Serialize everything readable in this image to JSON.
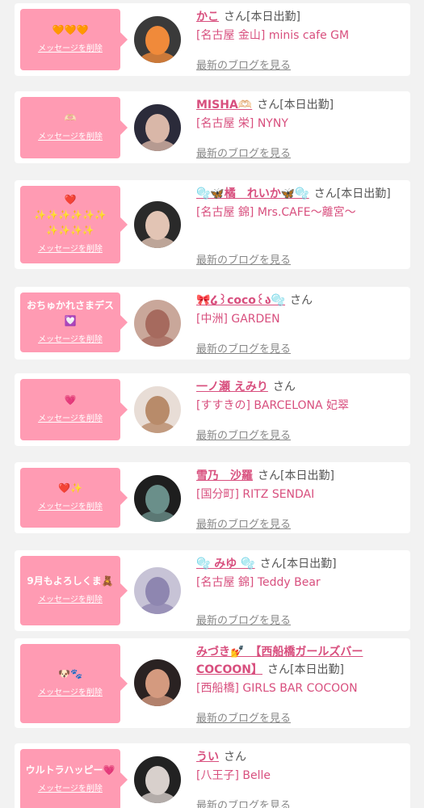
{
  "common": {
    "delete_label": "メッセージを削除",
    "blog_label": "最新のブログを見る",
    "san": "さん"
  },
  "cards": [
    {
      "message": "🧡🧡🧡",
      "name": "かこ",
      "status": "[本日出勤]",
      "shop": "[名古屋 金山] minis cafe GM",
      "avatar_colors": [
        "#3a3a3a",
        "#f08a3a"
      ]
    },
    {
      "message": "🫶🏻",
      "name": "MISHA🫶🏻",
      "status": "[本日出勤]",
      "shop": "[名古屋 栄] NYNY",
      "avatar_colors": [
        "#2b2b3a",
        "#d9b7a8"
      ]
    },
    {
      "message": "❤️\n✨✨✨✨✨✨\n✨✨✨✨",
      "name": "🫧🦋橘　れいか🦋🫧",
      "status": "[本日出勤]",
      "shop": "[名古屋 錦] Mrs.CAFE～離宮～",
      "avatar_colors": [
        "#2a2a2a",
        "#e2c4b4"
      ]
    },
    {
      "message": "おちゅかれさまデス💟",
      "name": "🎀໒꒱coco꒰ა🫧",
      "status": "",
      "shop": "[中洲] GARDEN",
      "avatar_colors": [
        "#c9a79a",
        "#a66a5e"
      ]
    },
    {
      "message": "💗",
      "name": "一ノ瀬 えみり",
      "status": "",
      "shop": "[すすきの] BARCELONA 妃翠",
      "avatar_colors": [
        "#e8ddd6",
        "#b88b6a"
      ]
    },
    {
      "message": "❤️✨",
      "name": "雪乃　沙羅",
      "status": "[本日出勤]",
      "shop": "[国分町] RITZ SENDAI",
      "avatar_colors": [
        "#1e1e1e",
        "#6a8f8a"
      ]
    },
    {
      "message": "9月もよろしくま🧸",
      "name": "🫧 みゆ 🫧",
      "status": "[本日出勤]",
      "shop": "[名古屋 錦] Teddy Bear",
      "avatar_colors": [
        "#c7c3d6",
        "#8e86b0"
      ]
    },
    {
      "message": "🐶🐾",
      "name": "みづき💅　【西船橋ガールズバーCOCOON】",
      "status": "[本日出勤]",
      "shop": "[西船橋] GIRLS BAR COCOON",
      "avatar_colors": [
        "#2a2222",
        "#d49a7f"
      ]
    },
    {
      "message": "ウルトラハッピー💗",
      "name": "うい",
      "status": "",
      "shop": "[八王子] Belle",
      "avatar_colors": [
        "#222222",
        "#d8d0cc"
      ]
    }
  ]
}
